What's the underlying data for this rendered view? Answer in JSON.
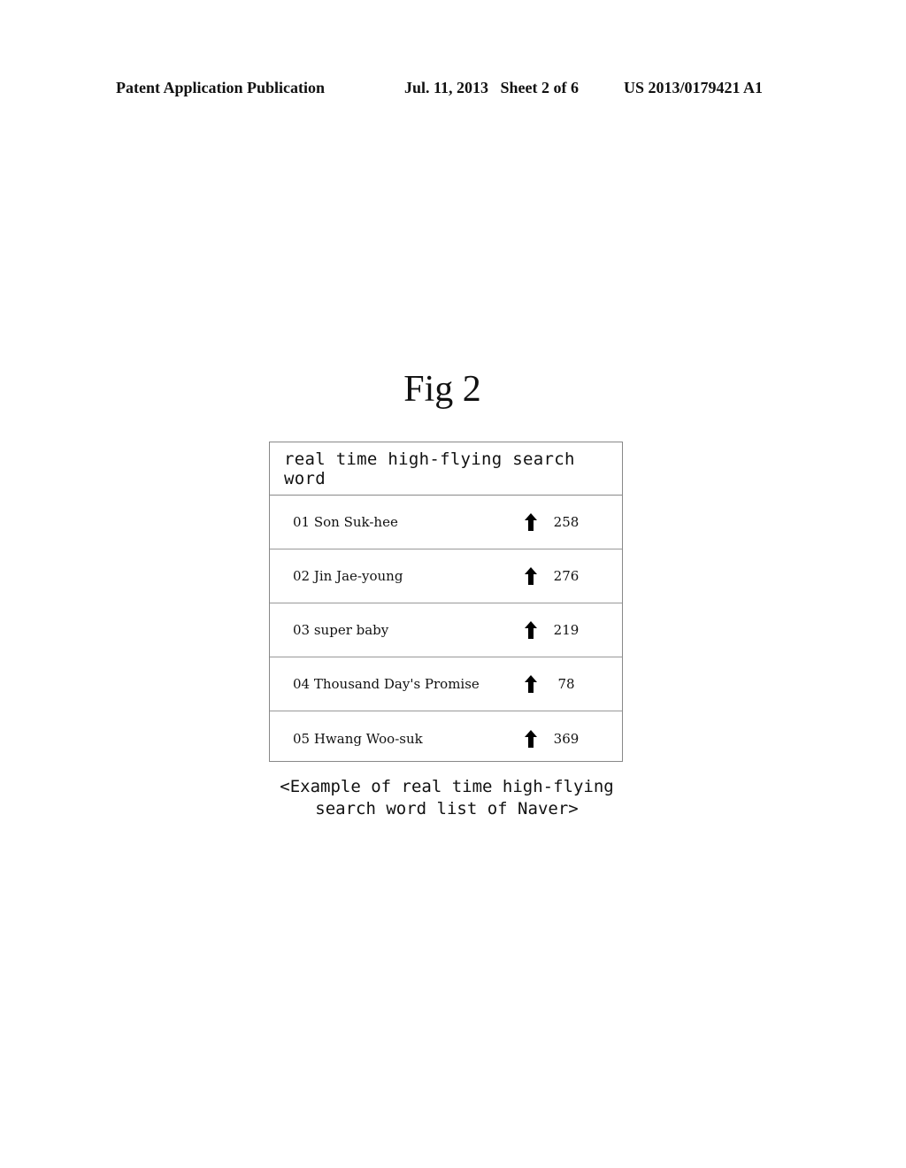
{
  "header": {
    "left": "Patent Application Publication",
    "middle": "Jul. 11, 2013   Sheet 2 of 6",
    "right": "US 2013/0179421 A1"
  },
  "figure": {
    "title": "Fig 2",
    "table": {
      "heading": "real time high-flying search word",
      "rows": [
        {
          "rank": "01",
          "term": "Son Suk-hee",
          "trend_icon": "up-arrow-icon",
          "value": "258"
        },
        {
          "rank": "02",
          "term": "Jin Jae-young",
          "trend_icon": "up-arrow-icon",
          "value": "276"
        },
        {
          "rank": "03",
          "term": "super baby",
          "trend_icon": "up-arrow-icon",
          "value": "219"
        },
        {
          "rank": "04",
          "term": "Thousand Day's Promise",
          "trend_icon": "up-arrow-icon",
          "value": "78"
        },
        {
          "rank": "05",
          "term": "Hwang Woo-suk",
          "trend_icon": "up-arrow-icon",
          "value": "369"
        }
      ]
    },
    "caption_line1": "<Example of real time high-flying",
    "caption_line2": "search word list of Naver>"
  }
}
